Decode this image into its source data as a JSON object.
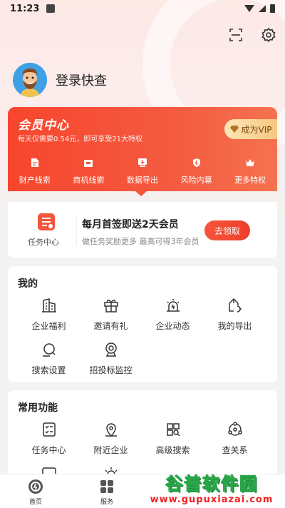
{
  "status_bar": {
    "time": "11:23"
  },
  "user": {
    "login_label": "登录快查"
  },
  "vip": {
    "title": "会员中心",
    "subtitle": "每天仅需要0.54元，即可享受21大特权",
    "button_label": "成为VIP",
    "items": [
      {
        "label": "财产线索",
        "icon": "document-icon"
      },
      {
        "label": "商机线索",
        "icon": "briefcase-icon"
      },
      {
        "label": "数据导出",
        "icon": "export-icon"
      },
      {
        "label": "风险内幕",
        "icon": "shield-icon"
      },
      {
        "label": "更多特权",
        "icon": "crown-icon"
      }
    ]
  },
  "task": {
    "icon_label": "任务中心",
    "title": "每月首签即送2天会员",
    "subtitle": "做任务奖励更多 最高可得3年会员",
    "button_label": "去领取"
  },
  "mine": {
    "title": "我的",
    "items": [
      {
        "label": "企业福利",
        "icon": "building-icon"
      },
      {
        "label": "邀请有礼",
        "icon": "gift-icon"
      },
      {
        "label": "企业动态",
        "icon": "alarm-icon"
      },
      {
        "label": "我的导出",
        "icon": "export-icon"
      },
      {
        "label": "搜索设置",
        "icon": "search-icon"
      },
      {
        "label": "招投标监控",
        "icon": "camera-icon"
      }
    ]
  },
  "common": {
    "title": "常用功能",
    "items": [
      {
        "label": "任务中心",
        "icon": "checklist-icon"
      },
      {
        "label": "附近企业",
        "icon": "location-icon"
      },
      {
        "label": "高级搜索",
        "icon": "advanced-search-icon"
      },
      {
        "label": "查关系",
        "icon": "relation-icon"
      }
    ]
  },
  "nav": {
    "items": [
      {
        "label": "首页",
        "icon": "home-icon"
      },
      {
        "label": "服务",
        "icon": "grid-icon"
      }
    ]
  },
  "watermark": {
    "title": "谷普软件园",
    "url": "www.gupuxiazai.com"
  },
  "colors": {
    "accent": "#f4553c",
    "vip_gold": "#f6c780"
  }
}
